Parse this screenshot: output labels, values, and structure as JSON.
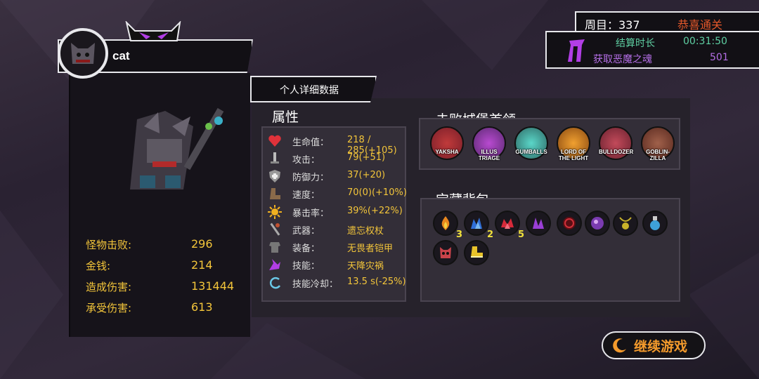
{
  "player": {
    "name": "cat",
    "stats": [
      {
        "label": "怪物击败:",
        "value": "296"
      },
      {
        "label": "金钱:",
        "value": "214"
      },
      {
        "label": "造成伤害:",
        "value": "131444"
      },
      {
        "label": "承受伤害:",
        "value": "613"
      }
    ]
  },
  "run": {
    "round_label": "周目：337",
    "clear_text": "恭喜通关",
    "time_label": "结算时长",
    "time_value": "00:31:50",
    "souls_label": "获取恶魔之魂",
    "souls_value": "501"
  },
  "detail": {
    "tab_label": "个人详细数据",
    "attr_title": "属性",
    "attributes": [
      {
        "icon": "heart-icon",
        "label": "生命值：",
        "value": "218 / 285(+105)"
      },
      {
        "icon": "sword-icon",
        "label": "攻击：",
        "value": "79(+51)"
      },
      {
        "icon": "shield-icon",
        "label": "防御力：",
        "value": "37(+20)"
      },
      {
        "icon": "boot-icon",
        "label": "速度：",
        "value": "70(0)(+10%)"
      },
      {
        "icon": "sunburst-icon",
        "label": "暴击率：",
        "value": "39%(+22%)"
      },
      {
        "icon": "weapon-icon",
        "label": "武器：",
        "value": "遗忘权杖"
      },
      {
        "icon": "armor-icon",
        "label": "装备：",
        "value": "无畏者铠甲"
      },
      {
        "icon": "skill-icon",
        "label": "技能：",
        "value": "天降灾祸"
      },
      {
        "icon": "cooldown-icon",
        "label": "技能冷却：",
        "value": "13.5 s(-25%)"
      }
    ],
    "boss_title": "击败城堡首领",
    "bosses": [
      {
        "name": "YAKSHA",
        "color": "#7a1f2a"
      },
      {
        "name": "ILLUS TRIAGE",
        "color": "#5b2a72"
      },
      {
        "name": "GUMBALLS",
        "color": "#2f6a66"
      },
      {
        "name": "LORD OF THE LIGHT",
        "color": "#8a4a12"
      },
      {
        "name": "BULLDOZER",
        "color": "#6b2230"
      },
      {
        "name": "GOBLIN-ZILLA",
        "color": "#5a2a20"
      }
    ],
    "bag_title": "宝藏背包",
    "items": [
      {
        "icon": "fire-gem-icon",
        "color": "#e8871e",
        "count": "3"
      },
      {
        "icon": "ice-gem-icon",
        "color": "#2f6fd8",
        "count": "2"
      },
      {
        "icon": "red-crystal-icon",
        "color": "#d62a3a",
        "count": "5"
      },
      {
        "icon": "purple-crystal-icon",
        "color": "#9a3fd6",
        "count": ""
      },
      {
        "icon": "dark-orb-icon",
        "color": "#a3202a",
        "count": ""
      },
      {
        "icon": "void-orb-icon",
        "color": "#7a3bb0",
        "count": ""
      },
      {
        "icon": "amulet-icon",
        "color": "#c8b22a",
        "count": ""
      },
      {
        "icon": "potion-icon",
        "color": "#3ea0d8",
        "count": ""
      },
      {
        "icon": "mask-icon",
        "color": "#c8434a",
        "count": ""
      },
      {
        "icon": "gold-boot-icon",
        "color": "#e8c32a",
        "count": ""
      }
    ]
  },
  "continue_label": "继续游戏"
}
